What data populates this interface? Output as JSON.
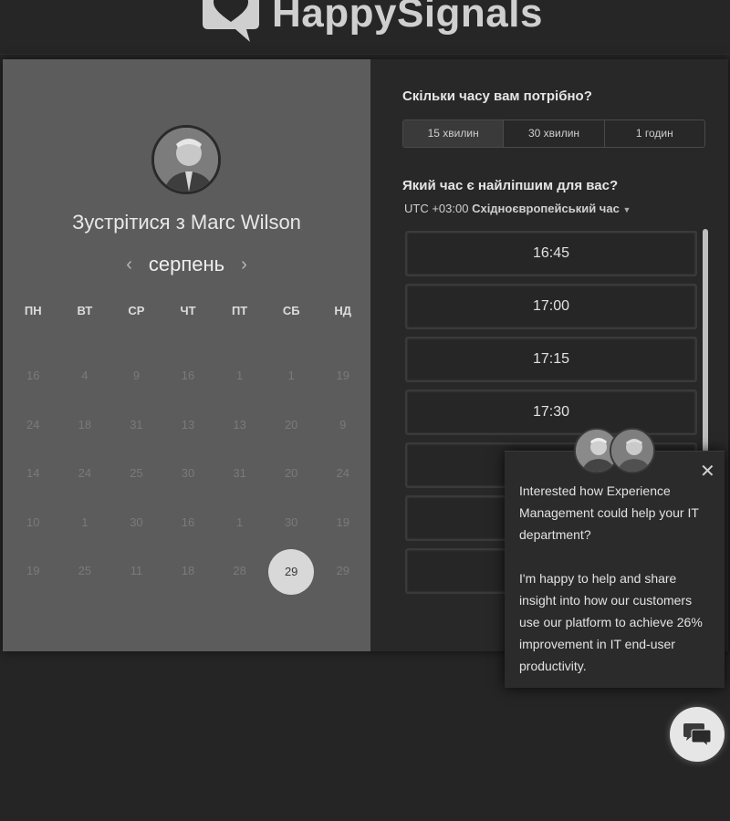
{
  "header": {
    "brand": "HappySignals"
  },
  "host": {
    "meet_title": "Зустрітися з Marc Wilson",
    "month": "серпень"
  },
  "calendar": {
    "weekdays": [
      "ПН",
      "ВТ",
      "СР",
      "ЧТ",
      "ПТ",
      "СБ",
      "НД"
    ],
    "weeks": [
      [
        "16",
        "4",
        "9",
        "16",
        "1",
        "1",
        "19"
      ],
      [
        "24",
        "18",
        "31",
        "13",
        "13",
        "20",
        "9"
      ],
      [
        "14",
        "24",
        "25",
        "30",
        "31",
        "20",
        "24"
      ],
      [
        "10",
        "1",
        "30",
        "16",
        "1",
        "30",
        "19"
      ],
      [
        "19",
        "25",
        "11",
        "18",
        "28",
        "29",
        "29"
      ]
    ],
    "selected_day": "29"
  },
  "duration": {
    "question": "Скільки часу вам потрібно?",
    "options": [
      "15 хвилин",
      "30 хвилин",
      "1 годин"
    ],
    "active_index": 0
  },
  "time": {
    "question": "Який час є найліпшим для вас?",
    "timezone_offset": "UTC +03:00",
    "timezone_name": "Східноєвропейський час",
    "slots": [
      "16:45",
      "17:00",
      "17:15",
      "17:30",
      "",
      "",
      ""
    ]
  },
  "popup": {
    "paragraph1": "Interested how Experience Management could help your IT department?",
    "paragraph2": "I'm happy to help and share insight into how our customers use our platform to achieve 26% improvement in IT end-user productivity."
  }
}
